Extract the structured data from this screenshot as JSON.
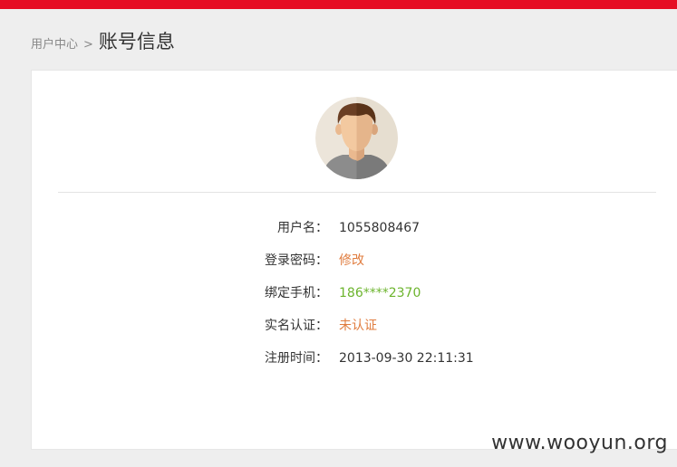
{
  "colors": {
    "top_bar": "#e60d23",
    "link": "#e07c3e",
    "phone": "#6cb42d"
  },
  "breadcrumb": {
    "parent": "用户中心",
    "separator": ">",
    "current": "账号信息"
  },
  "avatar": {
    "icon": "user-avatar-icon"
  },
  "info": {
    "username": {
      "label": "用户名：",
      "value": "1055808467"
    },
    "password": {
      "label": "登录密码：",
      "value": "修改"
    },
    "phone": {
      "label": "绑定手机：",
      "value": "186****2370"
    },
    "realname": {
      "label": "实名认证：",
      "value": "未认证"
    },
    "register_time": {
      "label": "注册时间：",
      "value": "2013-09-30 22:11:31"
    }
  },
  "watermark": "www.wooyun.org"
}
